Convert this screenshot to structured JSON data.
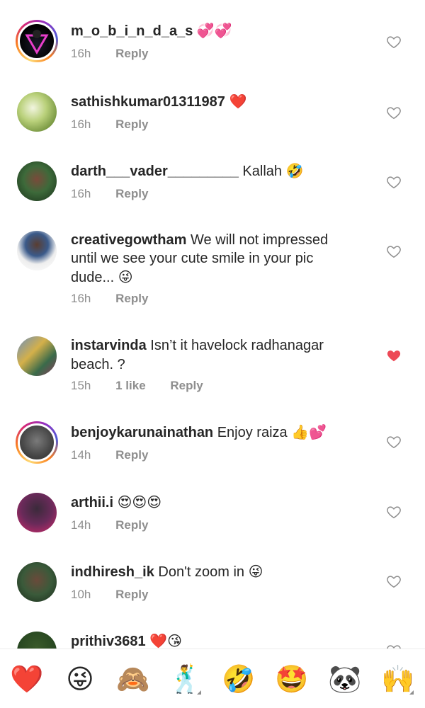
{
  "comments": [
    {
      "username": "m_o_b_i_n_d_a_s",
      "text": "",
      "emoji": "💞💞",
      "time": "16h",
      "likes": "",
      "reply": "Reply",
      "liked": false
    },
    {
      "username": "sathishkumar01311987",
      "text": "",
      "emoji": "❤️",
      "time": "16h",
      "likes": "",
      "reply": "Reply",
      "liked": false
    },
    {
      "username": "darth___vader_________",
      "text": "Kallah",
      "emoji": "🤣",
      "time": "16h",
      "likes": "",
      "reply": "Reply",
      "liked": false
    },
    {
      "username": "creativegowtham",
      "text": "We will not impressed until we see your cute smile in your pic dude...",
      "emoji": "😜",
      "time": "16h",
      "likes": "",
      "reply": "Reply",
      "liked": false
    },
    {
      "username": "instarvinda",
      "text": "Isn’t it havelock radhanagar beach. ?",
      "emoji": "",
      "time": "15h",
      "likes": "1 like",
      "reply": "Reply",
      "liked": true
    },
    {
      "username": "benjoykarunainathan",
      "text": "Enjoy raiza",
      "emoji": "👍💕",
      "time": "14h",
      "likes": "",
      "reply": "Reply",
      "liked": false
    },
    {
      "username": "arthii.i",
      "text": "",
      "emoji": "😍😍😍",
      "time": "14h",
      "likes": "",
      "reply": "Reply",
      "liked": false
    },
    {
      "username": "indhiresh_ik",
      "text": "Don't zoom in",
      "emoji": "😜",
      "time": "10h",
      "likes": "",
      "reply": "Reply",
      "liked": false
    },
    {
      "username": "prithiv3681",
      "text": "",
      "emoji": "❤️😘",
      "time": "",
      "likes": "",
      "reply": "",
      "liked": false
    }
  ],
  "quick_reactions": [
    "❤️",
    "😜",
    "🙈",
    "🕺",
    "🤣",
    "🤩",
    "🐼",
    "🙌"
  ],
  "colors": {
    "liked_heart": "#ed4956",
    "meta": "#8e8e8e",
    "text": "#262626"
  }
}
